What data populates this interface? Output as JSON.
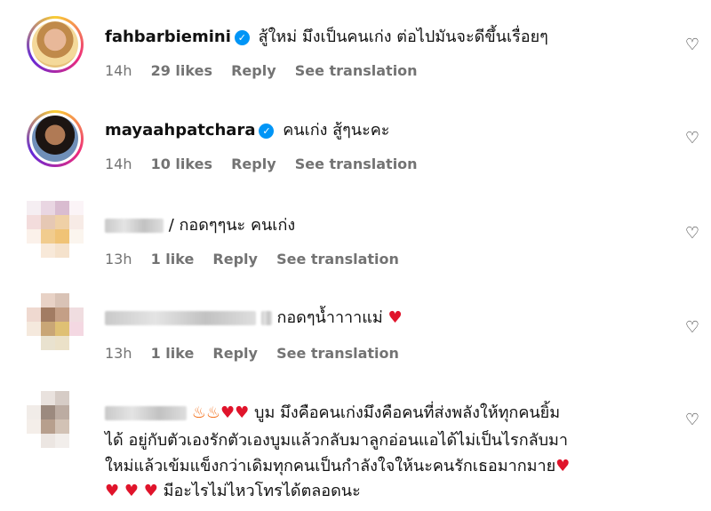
{
  "comments": [
    {
      "username": "fahbarbiemini",
      "verified": true,
      "text": "สู้ใหม่ มึงเป็นคนเก่ง ต่อไปมันจะดีขึ้นเรื่อยๆ",
      "time": "14h",
      "likes": "29 likes",
      "reply": "Reply",
      "see_translation": "See translation"
    },
    {
      "username": "mayaahpatchara",
      "verified": true,
      "text": "คนเก่ง สู้ๆนะคะ",
      "time": "14h",
      "likes": "10 likes",
      "reply": "Reply",
      "see_translation": "See translation"
    },
    {
      "username": "",
      "text": "/ กอดๆๆนะ คนเก่ง",
      "time": "13h",
      "likes": "1 like",
      "reply": "Reply",
      "see_translation": "See translation"
    },
    {
      "username": "",
      "text": "กอดๆน้ำาาาแม่",
      "time": "13h",
      "likes": "1 like",
      "reply": "Reply",
      "see_translation": "See translation"
    },
    {
      "username": "",
      "line1": "บูม มึงคือคนเก่งมึงคือคนที่ส่งพลังให้ทุกคนยิ้ม",
      "line2": "ได้ อยู่กับตัวเองรักตัวเองบูมแล้วกลับมาลูกอ่อนแอได้ไม่เป็นไรกลับมา",
      "line3": "ใหม่แล้วเข้มแข็งกว่าเดิมทุกคนเป็นกำลังใจให้นะคนรักเธอมากมาย",
      "line4": "มีอะไรไม่ไหวโทรได้ตลอดนะ"
    }
  ],
  "icons": {
    "heart_outline": "heart-outline-icon",
    "verified": "verified-badge-icon",
    "fire": "fire-emoji",
    "red_heart": "red-heart-emoji"
  },
  "colors": {
    "verified": "#0095f6",
    "meta_text": "#737373",
    "heart_red": "#e0142b"
  }
}
